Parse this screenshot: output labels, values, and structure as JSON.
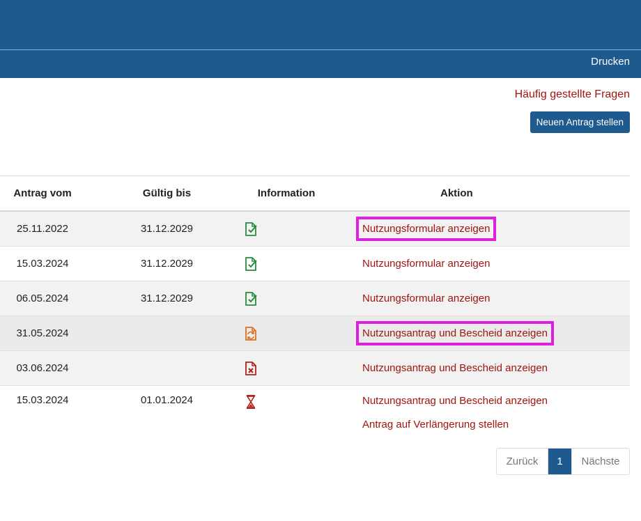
{
  "header": {
    "print_label": "Drucken"
  },
  "actions": {
    "faq_label": "Häufig gestellte Fragen",
    "new_request_label": "Neuen Antrag stellen"
  },
  "table": {
    "headers": [
      "Antrag vom",
      "Gültig bis",
      "Information",
      "Aktion"
    ],
    "rows": [
      {
        "date": "25.11.2022",
        "valid": "31.12.2029",
        "icon": "document-check-icon",
        "status_color": "#2a8a3e",
        "actions": [
          "Nutzungsformular anzeigen"
        ],
        "highlighted": true
      },
      {
        "date": "15.03.2024",
        "valid": "31.12.2029",
        "icon": "document-check-icon",
        "status_color": "#2a8a3e",
        "actions": [
          "Nutzungsformular anzeigen"
        ],
        "highlighted": false
      },
      {
        "date": "06.05.2024",
        "valid": "31.12.2029",
        "icon": "document-check-icon",
        "status_color": "#2a8a3e",
        "actions": [
          "Nutzungsformular anzeigen"
        ],
        "highlighted": false
      },
      {
        "date": "31.05.2024",
        "valid": "",
        "icon": "document-refresh-icon",
        "status_color": "#e07020",
        "actions": [
          "Nutzungsantrag und Bescheid anzeigen"
        ],
        "highlighted": true
      },
      {
        "date": "03.06.2024",
        "valid": "",
        "icon": "document-reject-icon",
        "status_color": "#b0201a",
        "actions": [
          "Nutzungsantrag und Bescheid anzeigen"
        ],
        "highlighted": false
      },
      {
        "date": "15.03.2024",
        "valid": "01.01.2024",
        "icon": "hourglass-icon",
        "status_color": "#b0201a",
        "actions": [
          "Nutzungsantrag und Bescheid anzeigen",
          "Antrag auf Verlängerung stellen"
        ],
        "highlighted": false
      }
    ]
  },
  "pagination": {
    "prev_label": "Zurück",
    "current_page": "1",
    "next_label": "Nächste"
  },
  "colors": {
    "brand_blue": "#1f5a8e",
    "link_red": "#a0150f",
    "highlight_magenta": "#e020e0"
  }
}
